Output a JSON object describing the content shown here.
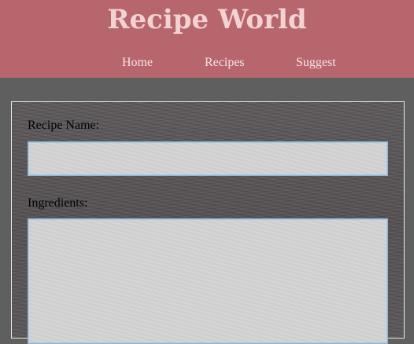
{
  "header": {
    "title": "Recipe World",
    "background_color": "#b6666c",
    "title_color": "#f3d2d2"
  },
  "nav": {
    "items": [
      {
        "label": "Home"
      },
      {
        "label": "Recipes"
      },
      {
        "label": "Suggest"
      }
    ]
  },
  "form": {
    "recipe_name": {
      "label": "Recipe Name:",
      "value": "",
      "placeholder": ""
    },
    "ingredients": {
      "label": "Ingredients:",
      "value": "",
      "placeholder": ""
    },
    "input_background": "#d3d2d3",
    "input_border": "#8db6d6"
  },
  "page_background": "#5f5f5f"
}
